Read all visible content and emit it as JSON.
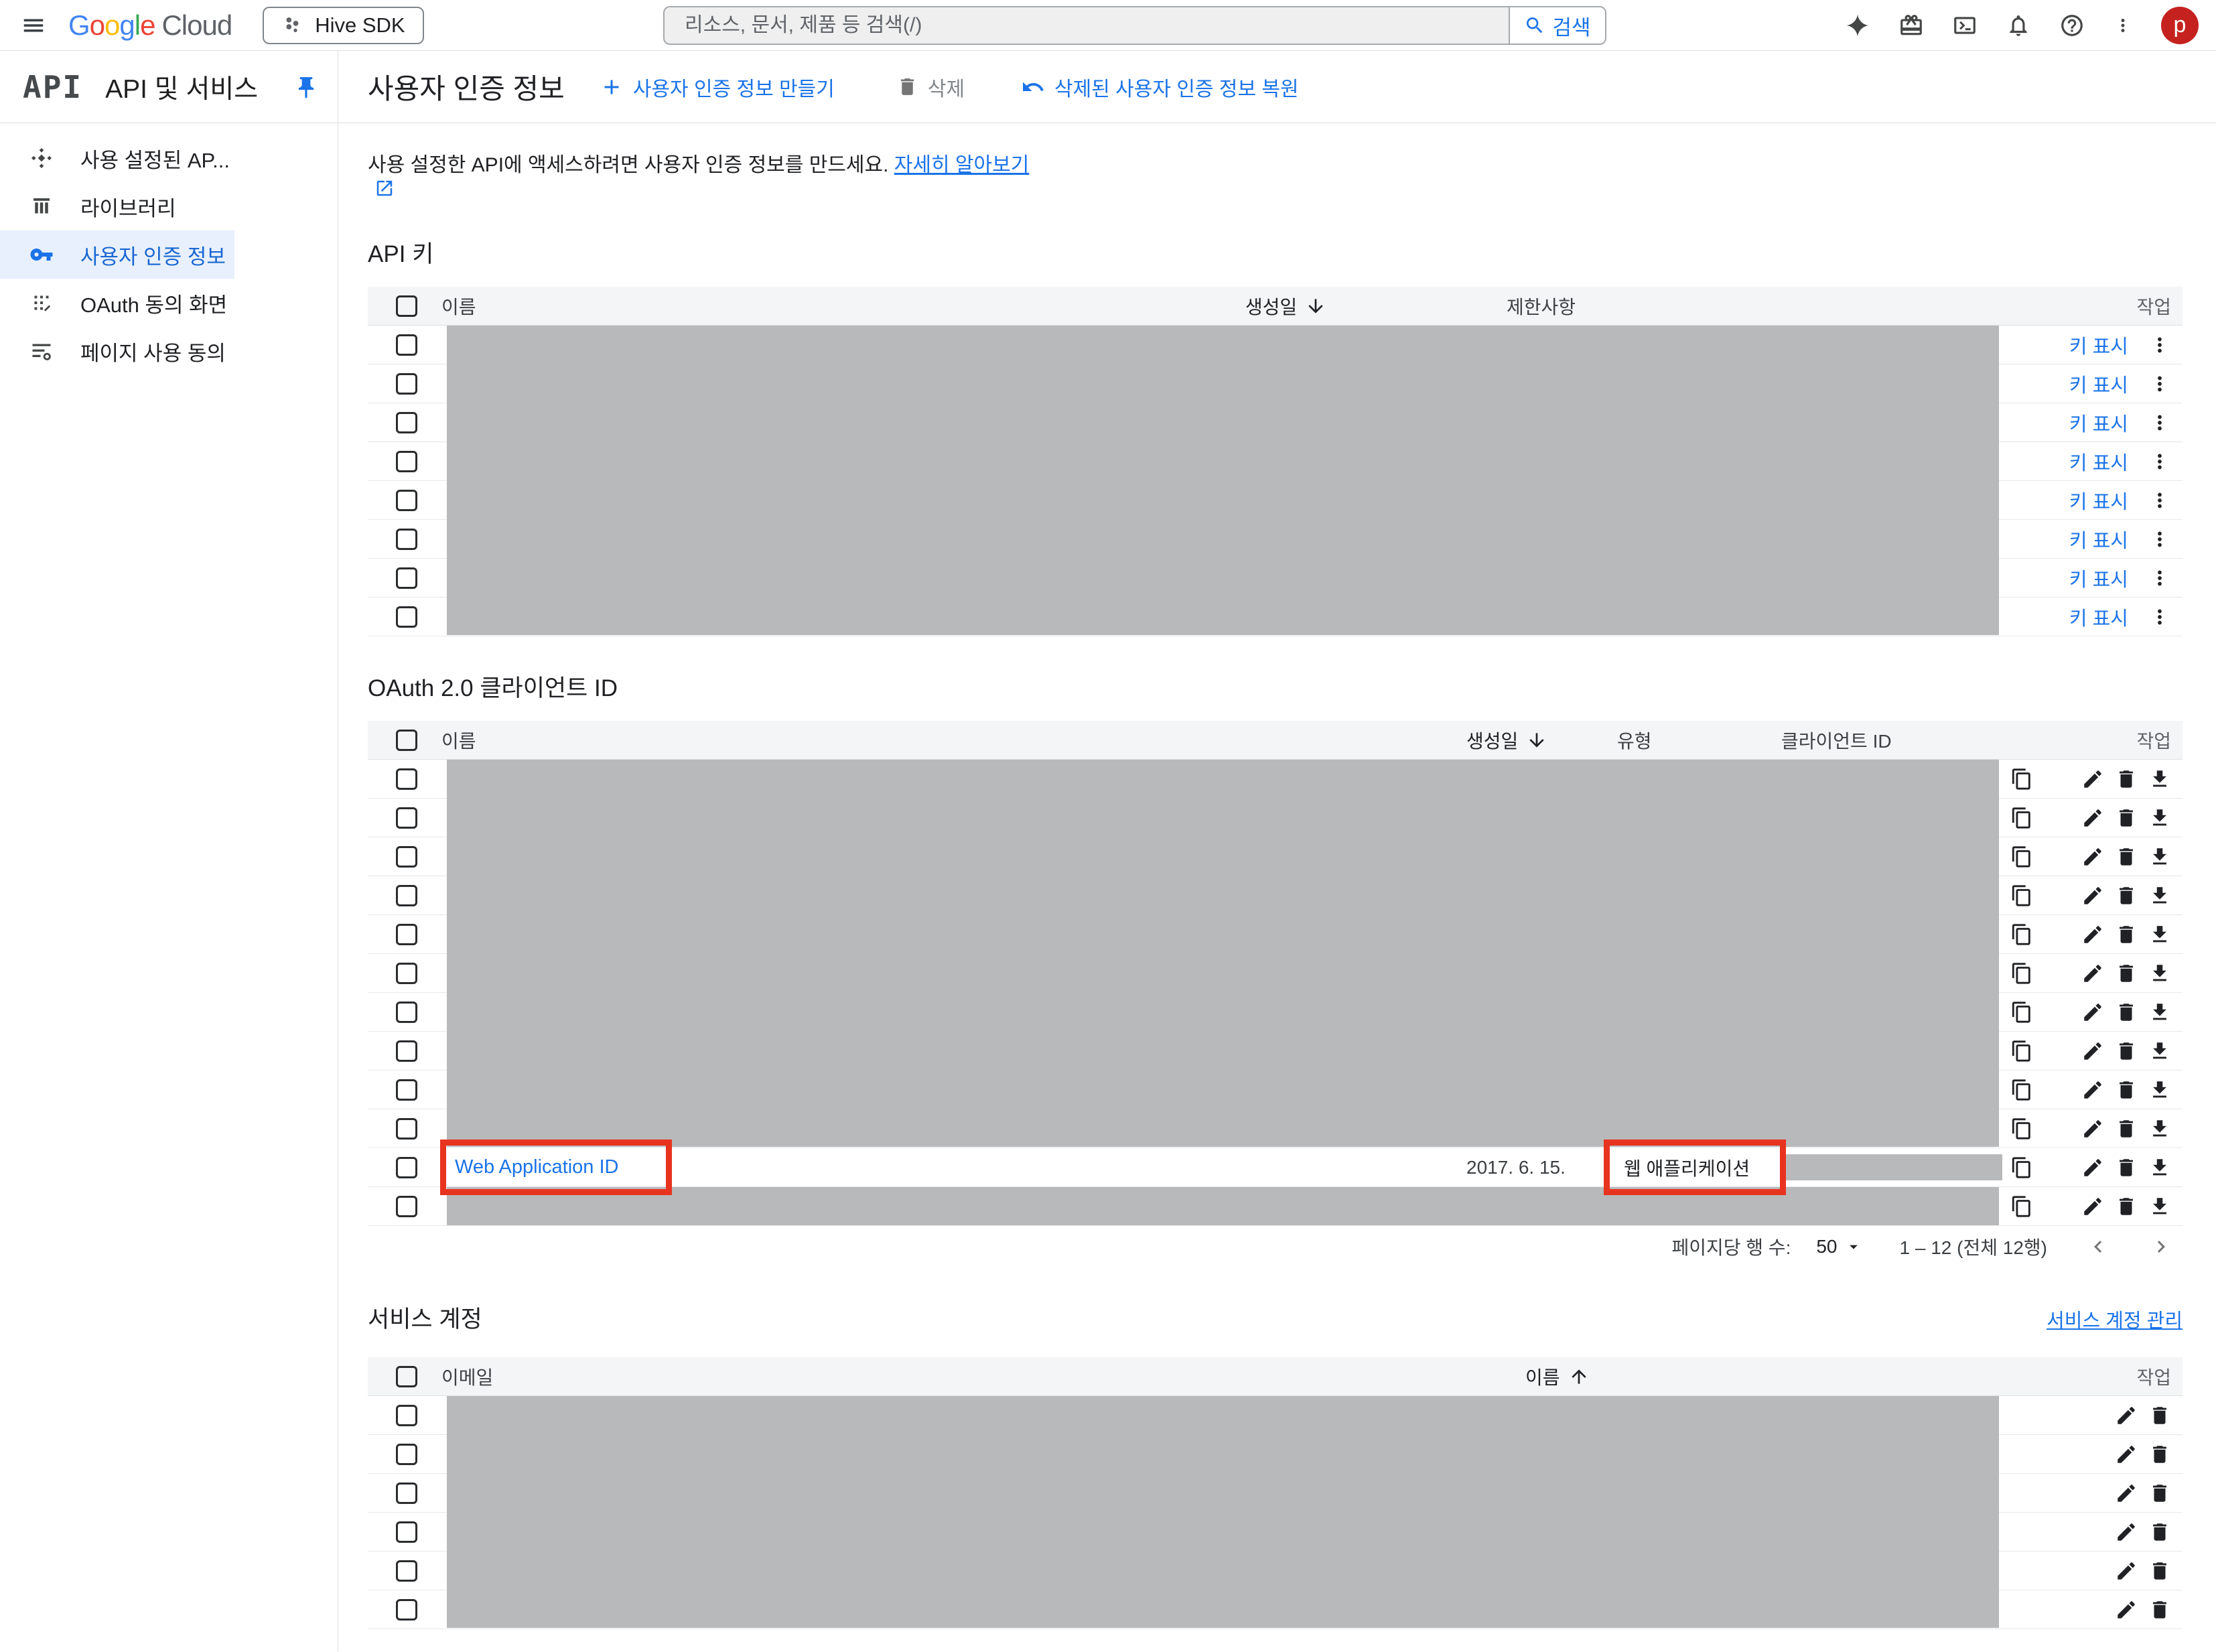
{
  "topbar": {
    "logo_letters": [
      [
        "G",
        "#4285F4"
      ],
      [
        "o",
        "#EA4335"
      ],
      [
        "o",
        "#FBBC05"
      ],
      [
        "g",
        "#4285F4"
      ],
      [
        "l",
        "#34A853"
      ],
      [
        "e",
        "#EA4335"
      ]
    ],
    "logo_cloud": "Cloud",
    "project_name": "Hive SDK",
    "search": {
      "placeholder": "리소스, 문서, 제품 등 검색(/)",
      "button": "검색"
    },
    "avatar_letter": "p"
  },
  "sidebar": {
    "product_glyph": "API",
    "title": "API 및 서비스",
    "items": [
      {
        "label": "사용 설정된 AP...",
        "icon": "enabled-apis-icon",
        "selected": false
      },
      {
        "label": "라이브러리",
        "icon": "library-icon",
        "selected": false
      },
      {
        "label": "사용자 인증 정보",
        "icon": "key-icon",
        "selected": true
      },
      {
        "label": "OAuth 동의 화면",
        "icon": "oauth-consent-icon",
        "selected": false
      },
      {
        "label": "페이지 사용 동의",
        "icon": "page-consent-icon",
        "selected": false
      }
    ]
  },
  "header": {
    "title": "사용자 인증 정보",
    "create_label": "사용자 인증 정보 만들기",
    "delete_label": "삭제",
    "restore_label": "삭제된 사용자 인증 정보 복원"
  },
  "intro": {
    "text": "사용 설정한 API에 액세스하려면 사용자 인증 정보를 만드세요.",
    "link_label": "자세히 알아보기"
  },
  "api_keys": {
    "title": "API 키",
    "columns": {
      "name": "이름",
      "created": "생성일",
      "restrictions": "제한사항",
      "actions": "작업"
    },
    "sort": {
      "column": "created",
      "direction": "desc"
    },
    "show_key_label": "키 표시",
    "rows": [
      {
        "redacted": true
      },
      {
        "redacted": true
      },
      {
        "redacted": true
      },
      {
        "redacted": true
      },
      {
        "redacted": true
      },
      {
        "redacted": true
      },
      {
        "redacted": true
      },
      {
        "redacted": true
      }
    ]
  },
  "oauth": {
    "title": "OAuth 2.0 클라이언트 ID",
    "columns": {
      "name": "이름",
      "created": "생성일",
      "type": "유형",
      "client_id": "클라이언트 ID",
      "actions": "작업"
    },
    "sort": {
      "column": "created",
      "direction": "desc"
    },
    "rows": [
      {
        "redacted": true
      },
      {
        "redacted": true
      },
      {
        "redacted": true
      },
      {
        "redacted": true
      },
      {
        "redacted": true
      },
      {
        "redacted": true
      },
      {
        "redacted": true
      },
      {
        "redacted": true
      },
      {
        "redacted": true
      },
      {
        "redacted": true
      },
      {
        "redacted": false,
        "name": "Web Application ID",
        "created": "2017. 6. 15.",
        "type": "웹 애플리케이션",
        "client_id_redacted": true,
        "annotated": true
      },
      {
        "redacted": true
      }
    ],
    "pagination": {
      "rows_per_page_label": "페이지당 행 수:",
      "rows_per_page": "50",
      "range": "1 – 12 (전체 12행)"
    }
  },
  "service_accounts": {
    "title": "서비스 계정",
    "manage_label": "서비스 계정 관리",
    "columns": {
      "email": "이메일",
      "name": "이름",
      "actions": "작업"
    },
    "sort": {
      "column": "name",
      "direction": "asc"
    },
    "rows": [
      {
        "redacted": true
      },
      {
        "redacted": true
      },
      {
        "redacted": true
      },
      {
        "redacted": true
      },
      {
        "redacted": true
      },
      {
        "redacted": true
      }
    ]
  },
  "colors": {
    "accent": "#1a73e8",
    "text": "#202124",
    "border": "#e0e0e0",
    "header-bg": "#f4f5f6",
    "selected-bg": "#e8f0fe",
    "redaction": "#b8b9ba",
    "annotation": "#e8331f",
    "avatar": "#c5221f"
  }
}
